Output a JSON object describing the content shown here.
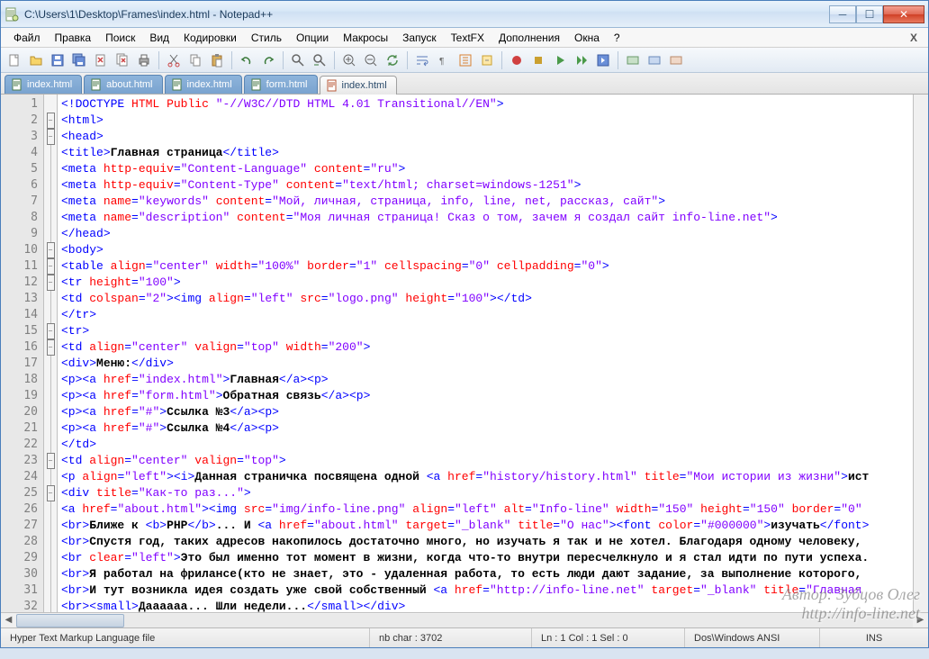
{
  "window": {
    "title": "C:\\Users\\1\\Desktop\\Frames\\index.html - Notepad++"
  },
  "menu": {
    "items": [
      "Файл",
      "Правка",
      "Поиск",
      "Вид",
      "Кодировки",
      "Стиль",
      "Опции",
      "Макросы",
      "Запуск",
      "TextFX",
      "Дополнения",
      "Окна",
      "?"
    ]
  },
  "tabs": [
    {
      "label": "index.html",
      "active": false
    },
    {
      "label": "about.html",
      "active": false
    },
    {
      "label": "index.html",
      "active": false
    },
    {
      "label": "form.html",
      "active": false
    },
    {
      "label": "index.html",
      "active": true
    }
  ],
  "statusbar": {
    "filetype": "Hyper Text Markup Language file",
    "nbchar": "nb char : 3702",
    "position": "Ln : 1   Col : 1   Sel : 0",
    "encoding": "Dos\\Windows  ANSI",
    "mode": "INS"
  },
  "watermark": {
    "line1": "Автор: Зубцов Олег",
    "line2": "http://info-line.net"
  },
  "code_lines_count": 32,
  "toolbar_icons": [
    "new-file",
    "open-file",
    "save",
    "save-all",
    "close",
    "close-all",
    "print",
    "cut",
    "copy",
    "paste",
    "undo",
    "redo",
    "find",
    "replace",
    "zoom-in",
    "zoom-out",
    "sync",
    "word-wrap",
    "show-all",
    "indent-guide",
    "fold",
    "record-macro",
    "play-macro",
    "stop-macro",
    "play-multiple",
    "save-macro",
    "toggle-1",
    "toggle-2",
    "toggle-3"
  ],
  "code": {
    "lines": [
      "<!DOCTYPE HTML Public \"-//W3C//DTD HTML 4.01 Transitional//EN\">",
      "<html>",
      "<head>",
      "<title>Главная страница</title>",
      "<meta http-equiv=\"Content-Language\" content=\"ru\">",
      "<meta http-equiv=\"Content-Type\" content=\"text/html; charset=windows-1251\">",
      "<meta name=\"keywords\" content=\"Мой, личная, страница, info, line, net, рассказ, сайт\">",
      "<meta name=\"description\" content=\"Моя личная страница! Сказ о том, зачем я создал сайт info-line.net\">",
      "</head>",
      "<body>",
      "<table align=\"center\" width=\"100%\" border=\"1\" cellspacing=\"0\" cellpadding=\"0\">",
      "<tr height=\"100\">",
      "<td colspan=\"2\"><img align=\"left\" src=\"logo.png\" height=\"100\"></td>",
      "</tr>",
      "<tr>",
      "<td align=\"center\" valign=\"top\" width=\"200\">",
      "<div>Меню:</div>",
      "<p><a href=\"index.html\">Главная</a><p>",
      "<p><a href=\"form.html\">Обратная связь</a><p>",
      "<p><a href=\"#\">Ссылка №3</a><p>",
      "<p><a href=\"#\">Ссылка №4</a><p>",
      "</td>",
      "<td align=\"center\" valign=\"top\">",
      "<p align=\"left\"><i>Данная страничка посвящена одной <a href=\"history/history.html\" title=\"Мои истории из жизни\">ист",
      "<div title=\"Как-то раз...\">",
      "<a href=\"about.html\"><img src=\"img/info-line.png\" align=\"left\" alt=\"Info-line\" width=\"150\" height=\"150\" border=\"0\"",
      "<br>Ближе к <b>PHP</b>... И <a href=\"about.html\" target=\"_blank\" title=\"О нас\"><font color=\"#000000\">изучать</font>",
      "<br>Спустя год, таких адресов накопилось достаточно много, но изучать я так и не хотел. Благодаря одному человеку,",
      "<br clear=\"left\">Это был именно тот момент в жизни, когда что-то внутри пересчелкнуло и я стал идти по пути успеха.",
      "<br>Я работал на фрилансе(кто не знает, это - удаленная работа, то есть люди дают задание, за выполнение которого,",
      "<br>И тут возникла идея создать уже свой собственный <a href=\"http://info-line.net\" target=\"_blank\" title=\"Главная",
      "<br><small>Даааааа... Шли недели...</small></div>"
    ]
  }
}
